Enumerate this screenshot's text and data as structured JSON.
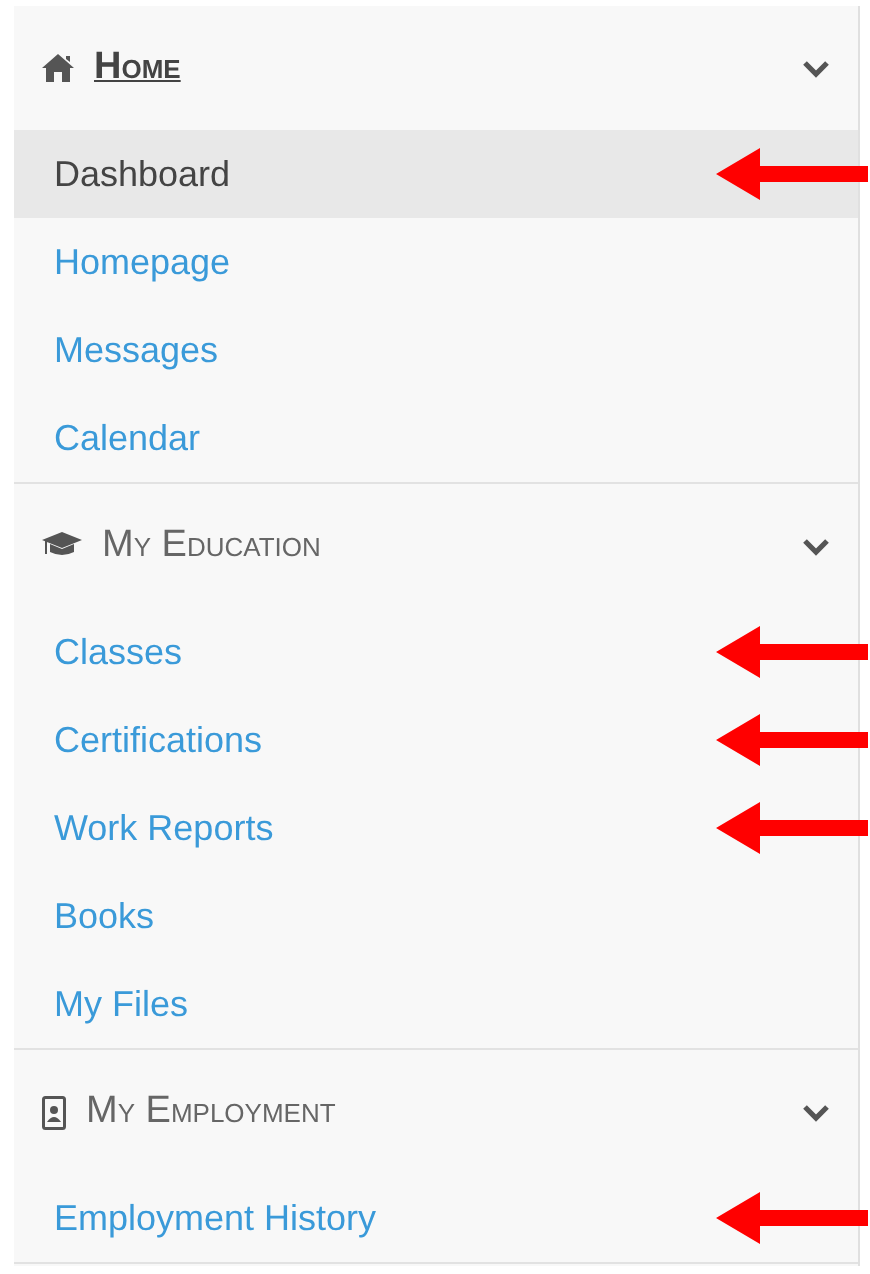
{
  "sections": [
    {
      "kind": "home",
      "title": "Home",
      "active": true,
      "expanded": true,
      "items": [
        {
          "label": "Dashboard",
          "selected": true,
          "arrow": true
        },
        {
          "label": "Homepage",
          "selected": false,
          "arrow": false
        },
        {
          "label": "Messages",
          "selected": false,
          "arrow": false
        },
        {
          "label": "Calendar",
          "selected": false,
          "arrow": false
        }
      ]
    },
    {
      "kind": "education",
      "title": "My Education",
      "active": false,
      "expanded": true,
      "items": [
        {
          "label": "Classes",
          "selected": false,
          "arrow": true
        },
        {
          "label": "Certifications",
          "selected": false,
          "arrow": true
        },
        {
          "label": "Work Reports",
          "selected": false,
          "arrow": true
        },
        {
          "label": "Books",
          "selected": false,
          "arrow": false
        },
        {
          "label": "My Files",
          "selected": false,
          "arrow": false
        }
      ]
    },
    {
      "kind": "employment",
      "title": "My Employment",
      "active": false,
      "expanded": true,
      "items": [
        {
          "label": "Employment History",
          "selected": false,
          "arrow": true
        }
      ]
    }
  ]
}
